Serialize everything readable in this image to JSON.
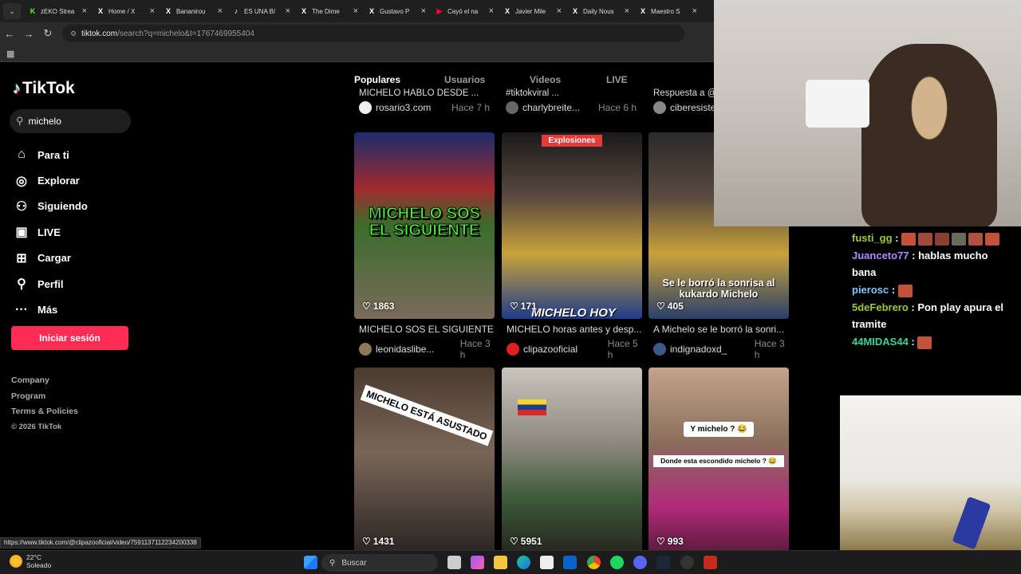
{
  "browser": {
    "tabs": [
      {
        "title": "zEKO Strea",
        "icon": "kick-icon",
        "color": "#53fc18"
      },
      {
        "title": "Home / X",
        "icon": "x-icon",
        "color": "#ffffff"
      },
      {
        "title": "Bananirou",
        "icon": "x-icon",
        "color": "#ffffff"
      },
      {
        "title": "ES UNA B/",
        "icon": "tiktok-icon",
        "color": "#ffffff"
      },
      {
        "title": "The Dime",
        "icon": "x-icon",
        "color": "#ffffff"
      },
      {
        "title": "Gustavo P",
        "icon": "x-icon",
        "color": "#ffffff"
      },
      {
        "title": "Cayó el na",
        "icon": "youtube-icon",
        "color": "#ff0033"
      },
      {
        "title": "Javier Mile",
        "icon": "x-icon",
        "color": "#ffffff"
      },
      {
        "title": "Daily Nous",
        "icon": "x-icon",
        "color": "#ffffff"
      },
      {
        "title": "Maestro S",
        "icon": "x-icon",
        "color": "#ffffff"
      }
    ],
    "url_host": "tiktok.com",
    "url_rest": "/search?q=michelo&t=1767469955404",
    "status_url": "https://www.tiktok.com/@clipazooficial/video/7591137112234200338"
  },
  "sidebar": {
    "logo": "TikTok",
    "search_value": "michelo",
    "menu": [
      {
        "label": "Para ti",
        "icon": "home-icon"
      },
      {
        "label": "Explorar",
        "icon": "compass-icon"
      },
      {
        "label": "Siguiendo",
        "icon": "following-icon"
      },
      {
        "label": "LIVE",
        "icon": "live-icon"
      },
      {
        "label": "Cargar",
        "icon": "upload-icon"
      },
      {
        "label": "Perfil",
        "icon": "profile-icon"
      },
      {
        "label": "Más",
        "icon": "more-icon"
      }
    ],
    "login_label": "Iniciar sesión",
    "footer": [
      "Company",
      "Program",
      "Terms & Policies"
    ],
    "copyright": "© 2026 TikTok"
  },
  "results": {
    "tabs": [
      "Populares",
      "Usuarios",
      "Videos",
      "LIVE"
    ],
    "active_tab": "Populares",
    "top_row": [
      {
        "caption": "MICHELO HABLO DESDE ...",
        "author": "rosario3.com",
        "time": "Hace 7 h"
      },
      {
        "caption": "#tiktokviral ...",
        "author": "charlybreite...",
        "time": "Hace 6 h"
      },
      {
        "caption": "Respuesta a @",
        "author": "ciberesiste",
        "time": ""
      }
    ],
    "cards": [
      {
        "likes": "1863",
        "caption": "MICHELO SOS EL SIGUIENTE",
        "author": "leonidaslibe...",
        "time": "Hace 3 h",
        "overlay": "MICHELO SOS EL SIGUIENTE"
      },
      {
        "likes": "171",
        "caption": "MICHELO horas antes y desp...",
        "author": "clipazooficial",
        "time": "Hace 5 h",
        "overlay_top": "Explosiones",
        "overlay_bottom": "MICHELO HOY"
      },
      {
        "likes": "405",
        "caption": "A Michelo se le borró la sonri...",
        "author": "indignadoxd_",
        "time": "Hace 3 h",
        "overlay": "Se le borró la sonrisa al kukardo Michelo"
      },
      {
        "likes": "1431",
        "overlay": "MICHELO ESTÁ ASUSTADO"
      },
      {
        "likes": "5951"
      },
      {
        "likes": "993",
        "overlay": "Y michelo ? 😂",
        "overlay2": "Donde esta escondido michelo ? 😂"
      }
    ]
  },
  "chat": [
    {
      "user": "fusti_gg",
      "color": "#9acd32",
      "text": ""
    },
    {
      "user": "Juanceto77",
      "color": "#b28bff",
      "text": "hablas mucho bana"
    },
    {
      "user": "pierosc",
      "color": "#7ec8ff",
      "text": ""
    },
    {
      "user": "5deFebrero",
      "color": "#9acd32",
      "text": "Pon play apura el tramite"
    },
    {
      "user": "44MIDAS44",
      "color": "#3ad29f",
      "text": ""
    }
  ],
  "taskbar": {
    "temp": "22°C",
    "condition": "Soleado",
    "search_label": "Buscar"
  }
}
